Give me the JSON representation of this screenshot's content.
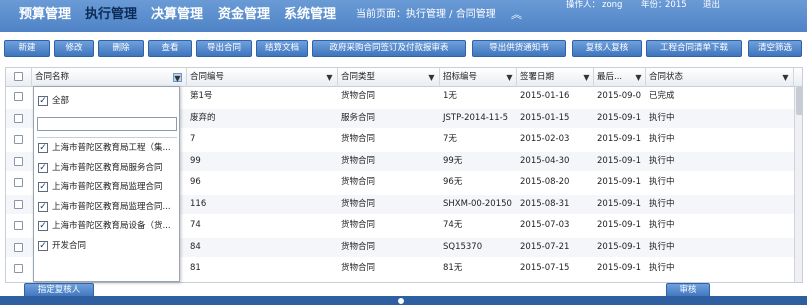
{
  "nav": {
    "items": [
      "预算管理",
      "执行管理",
      "决算管理",
      "资金管理",
      "系统管理"
    ],
    "active_index": 1,
    "breadcrumb": "当前页面：执行管理 / 合同管理",
    "operator_label": "操作人：",
    "operator": "zong",
    "year_label": "年份：",
    "year": "2015",
    "logout": "退出"
  },
  "toolbar": {
    "buttons": [
      "新建",
      "修改",
      "删除",
      "查看",
      "导出合同",
      "结算文档",
      "政府采购合同签订及付款报审表",
      "导出供货通知书",
      "复核人复核",
      "工程合同清单下载",
      "清空筛选"
    ]
  },
  "table": {
    "columns": [
      "合同名称",
      "合同编号",
      "合同类型",
      "招标编号",
      "签署日期",
      "最后...",
      "合同状态"
    ],
    "rows": [
      {
        "number": "第1号",
        "type": "货物合同",
        "bid": "1无",
        "date": "2015-01-16",
        "last": "2015-09-0",
        "status": "已完成"
      },
      {
        "number": "废弃的",
        "type": "服务合同",
        "bid": "JSTP-2014-11-5",
        "date": "2015-01-15",
        "last": "2015-09-1",
        "status": "执行中"
      },
      {
        "number": "7",
        "type": "货物合同",
        "bid": "7无",
        "date": "2015-02-03",
        "last": "2015-09-1",
        "status": "执行中"
      },
      {
        "number": "99",
        "type": "货物合同",
        "bid": "99无",
        "date": "2015-04-30",
        "last": "2015-09-1",
        "status": "执行中"
      },
      {
        "number": "96",
        "type": "货物合同",
        "bid": "96无",
        "date": "2015-08-20",
        "last": "2015-09-1",
        "status": "执行中"
      },
      {
        "number": "116",
        "type": "货物合同",
        "bid": "SHXM-00-20150",
        "date": "2015-08-31",
        "last": "2015-09-1",
        "status": "执行中"
      },
      {
        "number": "74",
        "type": "货物合同",
        "bid": "74无",
        "date": "2015-07-03",
        "last": "2015-09-1",
        "status": "执行中"
      },
      {
        "number": "84",
        "type": "货物合同",
        "bid": "SQ15370",
        "date": "2015-07-21",
        "last": "2015-09-1",
        "status": "执行中"
      },
      {
        "number": "81",
        "type": "货物合同",
        "bid": "81无",
        "date": "2015-07-15",
        "last": "2015-09-1",
        "status": "执行中"
      }
    ]
  },
  "filter": {
    "select_all": "全部",
    "search_value": "",
    "options": [
      "上海市普陀区教育局工程（集...",
      "上海市普陀区教育局服务合同",
      "上海市普陀区教育局监理合同",
      "上海市普陀区教育局监理合同...",
      "上海市普陀区教育局设备（货...",
      "开发合同"
    ],
    "checked": "✓"
  },
  "bottom": {
    "left_button": "指定复核人",
    "right_button": "审核"
  },
  "icons": {
    "filter": "funnel-icon",
    "expand": "chevron-up-icon"
  },
  "colors": {
    "nav_bg": "#5b8fd0",
    "nav_active": "#0c2b56",
    "button_bg": "#4a80c6"
  }
}
